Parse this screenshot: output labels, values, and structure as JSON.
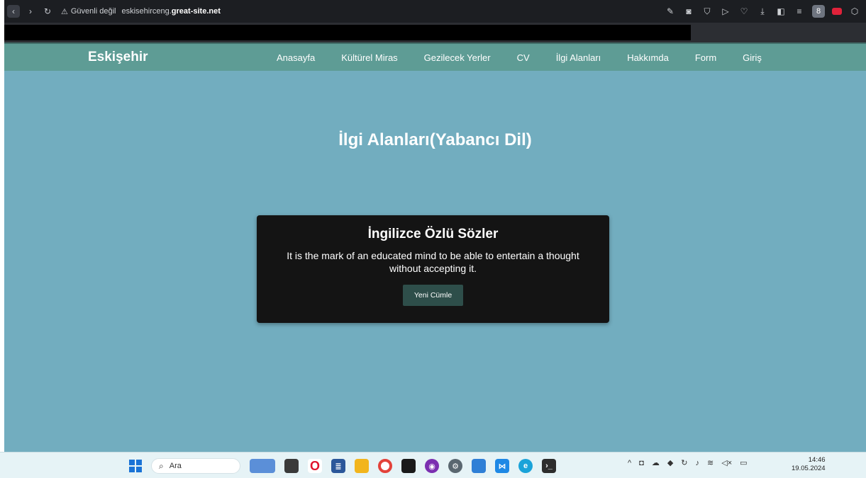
{
  "browser": {
    "security_label": "Güvenli değil",
    "url_subdomain": "eskisehirceng.",
    "url_domain": "great-site.net"
  },
  "site": {
    "brand": "Eskişehir",
    "menu": [
      {
        "label": "Anasayfa"
      },
      {
        "label": "Kültürel Miras"
      },
      {
        "label": "Gezilecek Yerler"
      },
      {
        "label": "CV"
      },
      {
        "label": "İlgi Alanları"
      },
      {
        "label": "Hakkımda"
      },
      {
        "label": "Form"
      },
      {
        "label": "Giriş"
      }
    ],
    "page_title": "İlgi Alanları(Yabancı Dil)"
  },
  "quote_card": {
    "title": "İngilizce Özlü Sözler",
    "quote": "It is the mark of an educated mind to be able to entertain a thought without accepting it.",
    "button_label": "Yeni Cümle"
  },
  "taskbar": {
    "search_placeholder": "Ara",
    "time": "14:46",
    "date": "19.05.2024"
  },
  "colors": {
    "page_bg": "#72adbf",
    "nav_bg": "#5e9c95",
    "card_bg": "#141414",
    "button_bg": "#2e4e4a"
  }
}
